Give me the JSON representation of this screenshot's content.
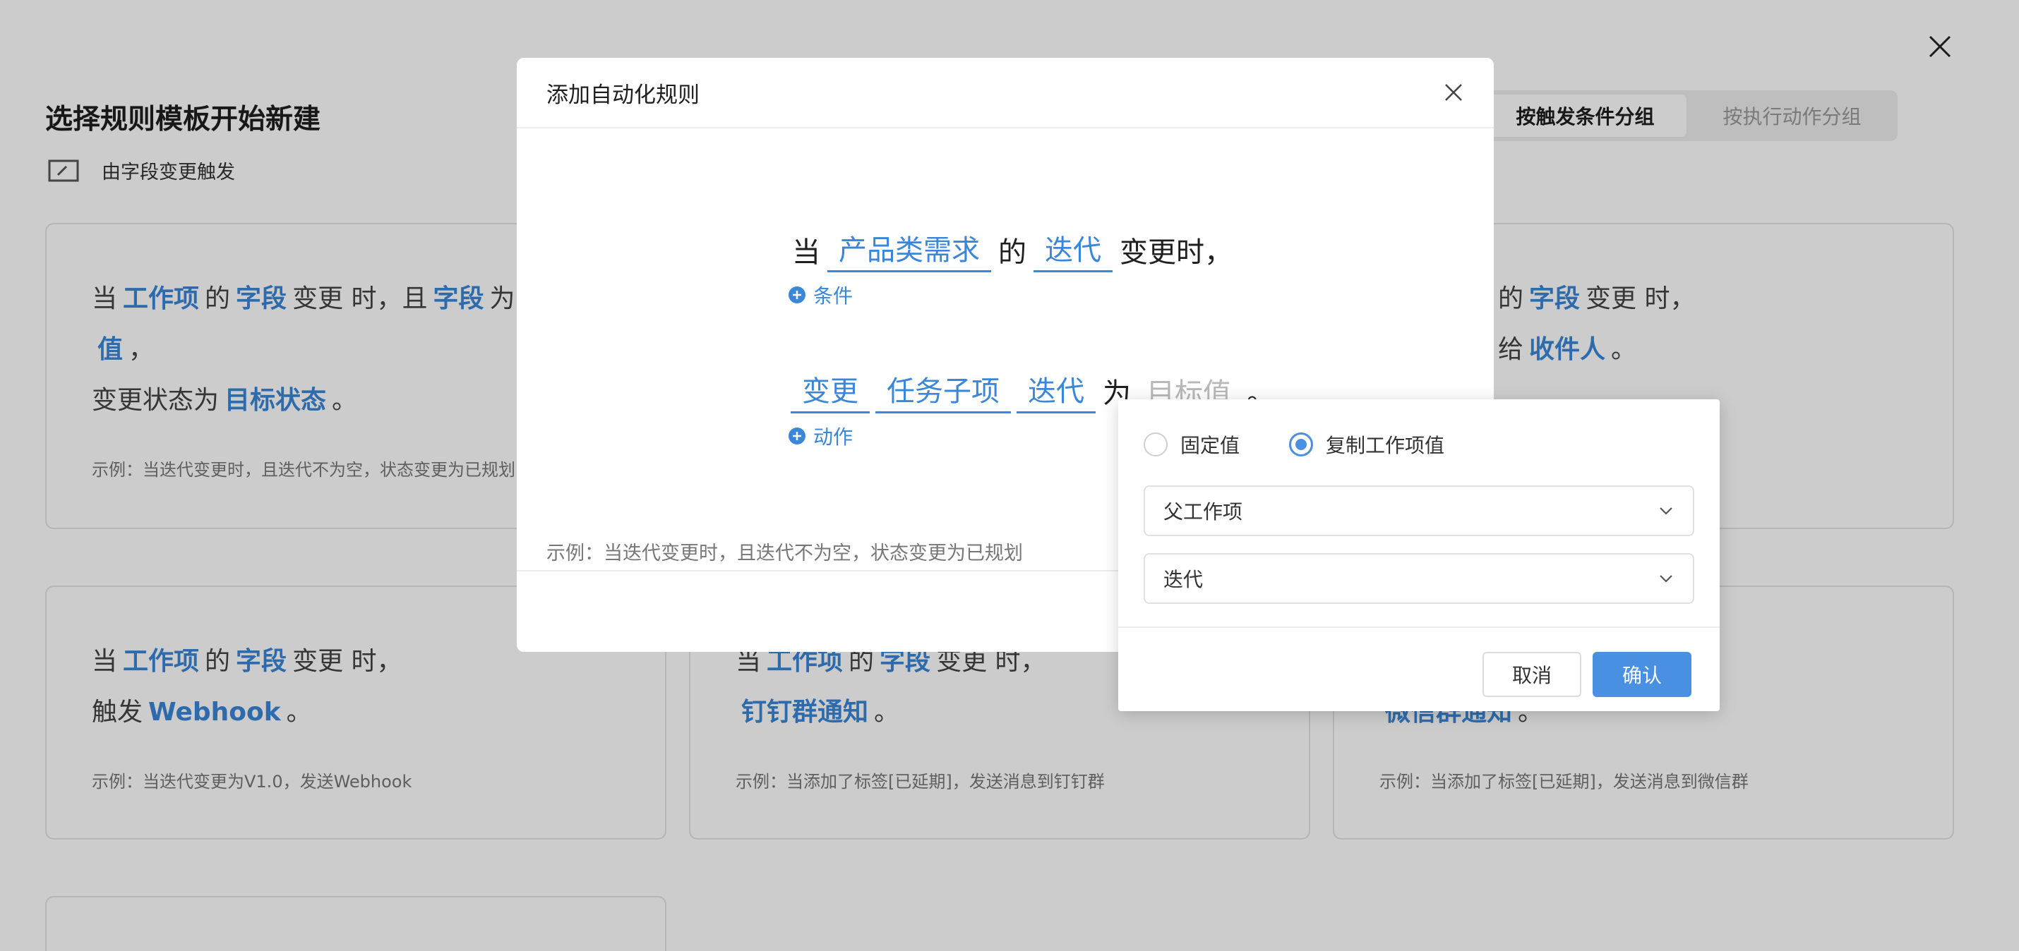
{
  "page": {
    "title": "选择规则模板开始新建",
    "trigger_label": "由字段变更触发",
    "group_tabs": [
      "按触发条件分组",
      "按执行动作分组"
    ],
    "cards": [
      {
        "lines": [
          [
            {
              "t": "当",
              "h": false
            },
            {
              "t": "工作项",
              "h": true
            },
            {
              "t": "的",
              "h": false
            },
            {
              "t": "字段",
              "h": true
            },
            {
              "t": "变更 时，且",
              "h": false
            },
            {
              "t": "字段",
              "h": true
            },
            {
              "t": "为",
              "h": false
            }
          ],
          [
            {
              "t": "值",
              "h": true
            },
            {
              "t": "，",
              "h": false
            }
          ],
          [
            {
              "t": "变更状态为",
              "h": false
            },
            {
              "t": "目标状态",
              "h": true
            },
            {
              "t": "。",
              "h": false
            }
          ]
        ],
        "example": "示例：当迭代变更时，且迭代不为空，状态变更为已规划"
      },
      {
        "lines": [
          [
            {
              "t": "的",
              "h": false
            },
            {
              "t": "字段",
              "h": true
            },
            {
              "t": "变更 时，",
              "h": false
            }
          ],
          [
            {
              "t": "给",
              "h": false
            },
            {
              "t": "收件人",
              "h": true
            },
            {
              "t": "。",
              "h": false
            }
          ]
        ],
        "example": ""
      },
      {
        "lines": [
          [
            {
              "t": "当",
              "h": false
            },
            {
              "t": "工作项",
              "h": true
            },
            {
              "t": "的",
              "h": false
            },
            {
              "t": "字段",
              "h": true
            },
            {
              "t": "变更 时，",
              "h": false
            }
          ],
          [
            {
              "t": "触发",
              "h": false
            },
            {
              "t": "Webhook",
              "h": true
            },
            {
              "t": "。",
              "h": false
            }
          ]
        ],
        "example": "示例：当迭代变更为V1.0，发送Webhook"
      },
      {
        "lines": [
          [
            {
              "t": "当",
              "h": false
            },
            {
              "t": "工作项",
              "h": true
            },
            {
              "t": "的",
              "h": false
            },
            {
              "t": "字段",
              "h": true
            },
            {
              "t": "变更 时，",
              "h": false
            }
          ],
          [
            {
              "t": "钉钉群通知",
              "h": true
            },
            {
              "t": "。",
              "h": false
            }
          ]
        ],
        "example": "示例：当添加了标签[已延期]，发送消息到钉钉群"
      },
      {
        "lines": [
          [],
          [
            {
              "t": "微信群通知",
              "h": true
            },
            {
              "t": "。",
              "h": false
            }
          ]
        ],
        "example": "示例：当添加了标签[已延期]，发送消息到微信群"
      },
      {
        "lines": [],
        "example": ""
      }
    ]
  },
  "dialog": {
    "title": "添加自动化规则",
    "rule_line1": {
      "prefix": "当",
      "token1": "产品类需求",
      "mid": "的",
      "token2": "迭代",
      "suffix": "变更时，"
    },
    "add_condition": "条件",
    "rule_line2": {
      "token1": "变更",
      "token2": "任务子项",
      "token3": "迭代",
      "mid": "为",
      "placeholder": "目标值",
      "suffix": "。"
    },
    "add_action": "动作",
    "example": "示例：当迭代变更时，且迭代不为空，状态变更为已规划"
  },
  "popover": {
    "radio_fixed": "固定值",
    "radio_copy": "复制工作项值",
    "selected_radio": "复制工作项值",
    "select1_value": "父工作项",
    "select2_value": "迭代",
    "cancel": "取消",
    "confirm": "确认"
  },
  "colors": {
    "accent": "#3a86d8",
    "primary_button": "#4a90e2",
    "overlay": "rgba(0,0,0,0.2)"
  },
  "icons": {
    "page_close": "close-icon",
    "trigger": "field-change-icon",
    "dialog_close": "close-icon",
    "add": "plus-circle-icon",
    "select_arrow": "chevron-down-icon"
  }
}
